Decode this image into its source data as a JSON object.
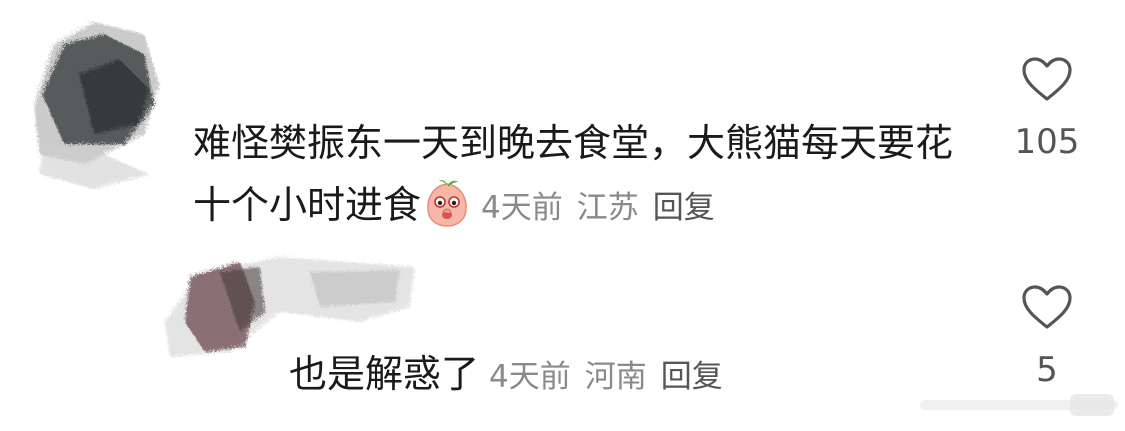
{
  "comments": [
    {
      "text": "难怪樊振东一天到晚去食堂，大熊猫每天要花十个小时进食",
      "emoji": "peach-face-emoji",
      "time": "4天前",
      "location": "江苏",
      "reply_label": "回复",
      "likes": "105"
    }
  ],
  "replies": [
    {
      "text": "也是解惑了",
      "time": "4天前",
      "location": "河南",
      "reply_label": "回复",
      "likes": "5"
    }
  ],
  "icons": {
    "like": "heart-outline-icon",
    "avatar": "blurred-avatar"
  },
  "colors": {
    "text": "#1a1a1a",
    "meta": "#8a8a8a",
    "icon": "#555555"
  }
}
